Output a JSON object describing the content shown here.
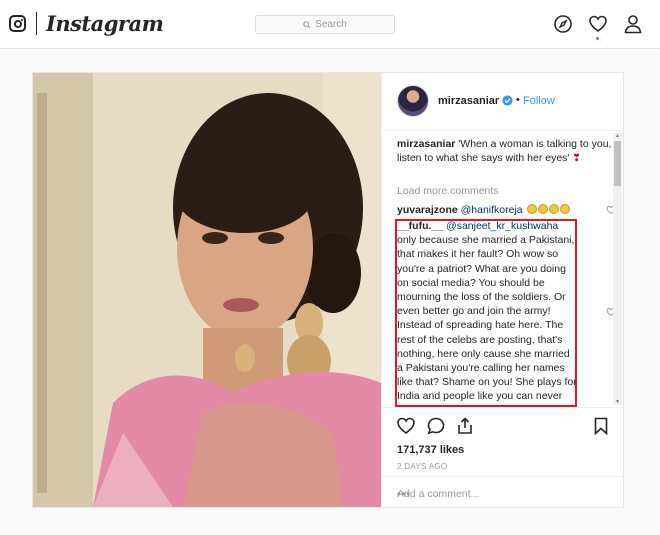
{
  "nav": {
    "wordmark": "Instagram",
    "search_placeholder": "Search"
  },
  "post": {
    "username": "mirzasaniar",
    "follow_label": "Follow",
    "separator": "•",
    "caption_user": "mirzasaniar",
    "caption_text": " 'When a woman is talking to you, listen to what she says with her eyes' ",
    "caption_emoji": "❣",
    "load_more": "Load more comments",
    "comment1": {
      "user": "yuvarajzone",
      "mention": "@hanifkoreja"
    },
    "comment2": {
      "user": "__fufu.__",
      "mention": "@sanjeet_kr_kushwaha",
      "text": " only because she married a Pakistani, that makes it her fault? Oh wow so you're a patriot? What are you doing on social media? You should be mourning the loss of the soldiers. Or even better go and join the army! Instead of spreading hate here. The rest of the celebs are posting, that's nothing, here only cause she married a Pakistani you're calling her names like that? Shame on you! She plays for India and people like you can never reach her level, that's why you take routes like this to get attention."
    },
    "likes": "171,737 likes",
    "time_ago": "2 DAYS AGO",
    "add_comment_placeholder": "Add a comment...",
    "more_label": "•••"
  },
  "colors": {
    "link": "#3897f0",
    "highlight_border": "#e8141f",
    "notification_dot": "#ed4956"
  }
}
